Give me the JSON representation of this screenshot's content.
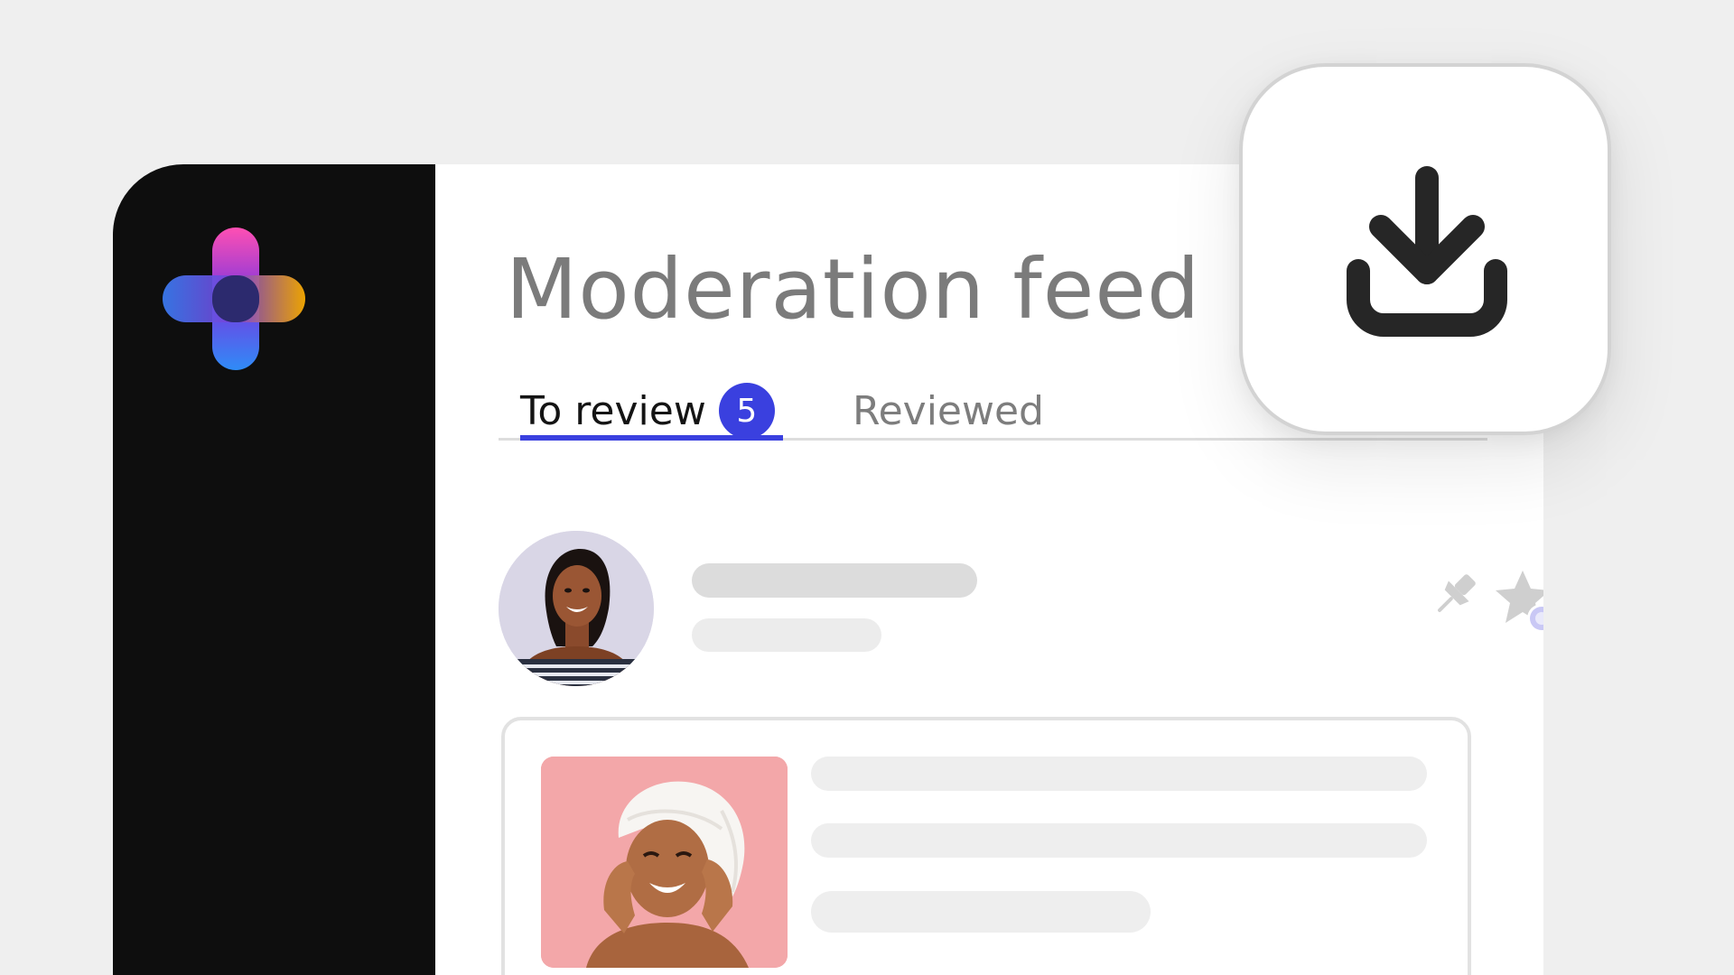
{
  "header": {
    "title": "Moderation feed"
  },
  "tabs": [
    {
      "label": "To review",
      "badge": "5",
      "active": true
    },
    {
      "label": "Reviewed",
      "active": false
    }
  ],
  "post": {
    "avatar": "woman-portrait-avatar",
    "actions": [
      "pin-icon",
      "star-icon"
    ]
  },
  "content_card": {
    "image": "woman-with-towel-photo"
  },
  "download_button": {
    "icon": "download-icon"
  },
  "colors": {
    "accent": "#3a40df",
    "sidebar": "#0e0e0e",
    "background": "#efefef",
    "title": "#7b7b7b"
  }
}
